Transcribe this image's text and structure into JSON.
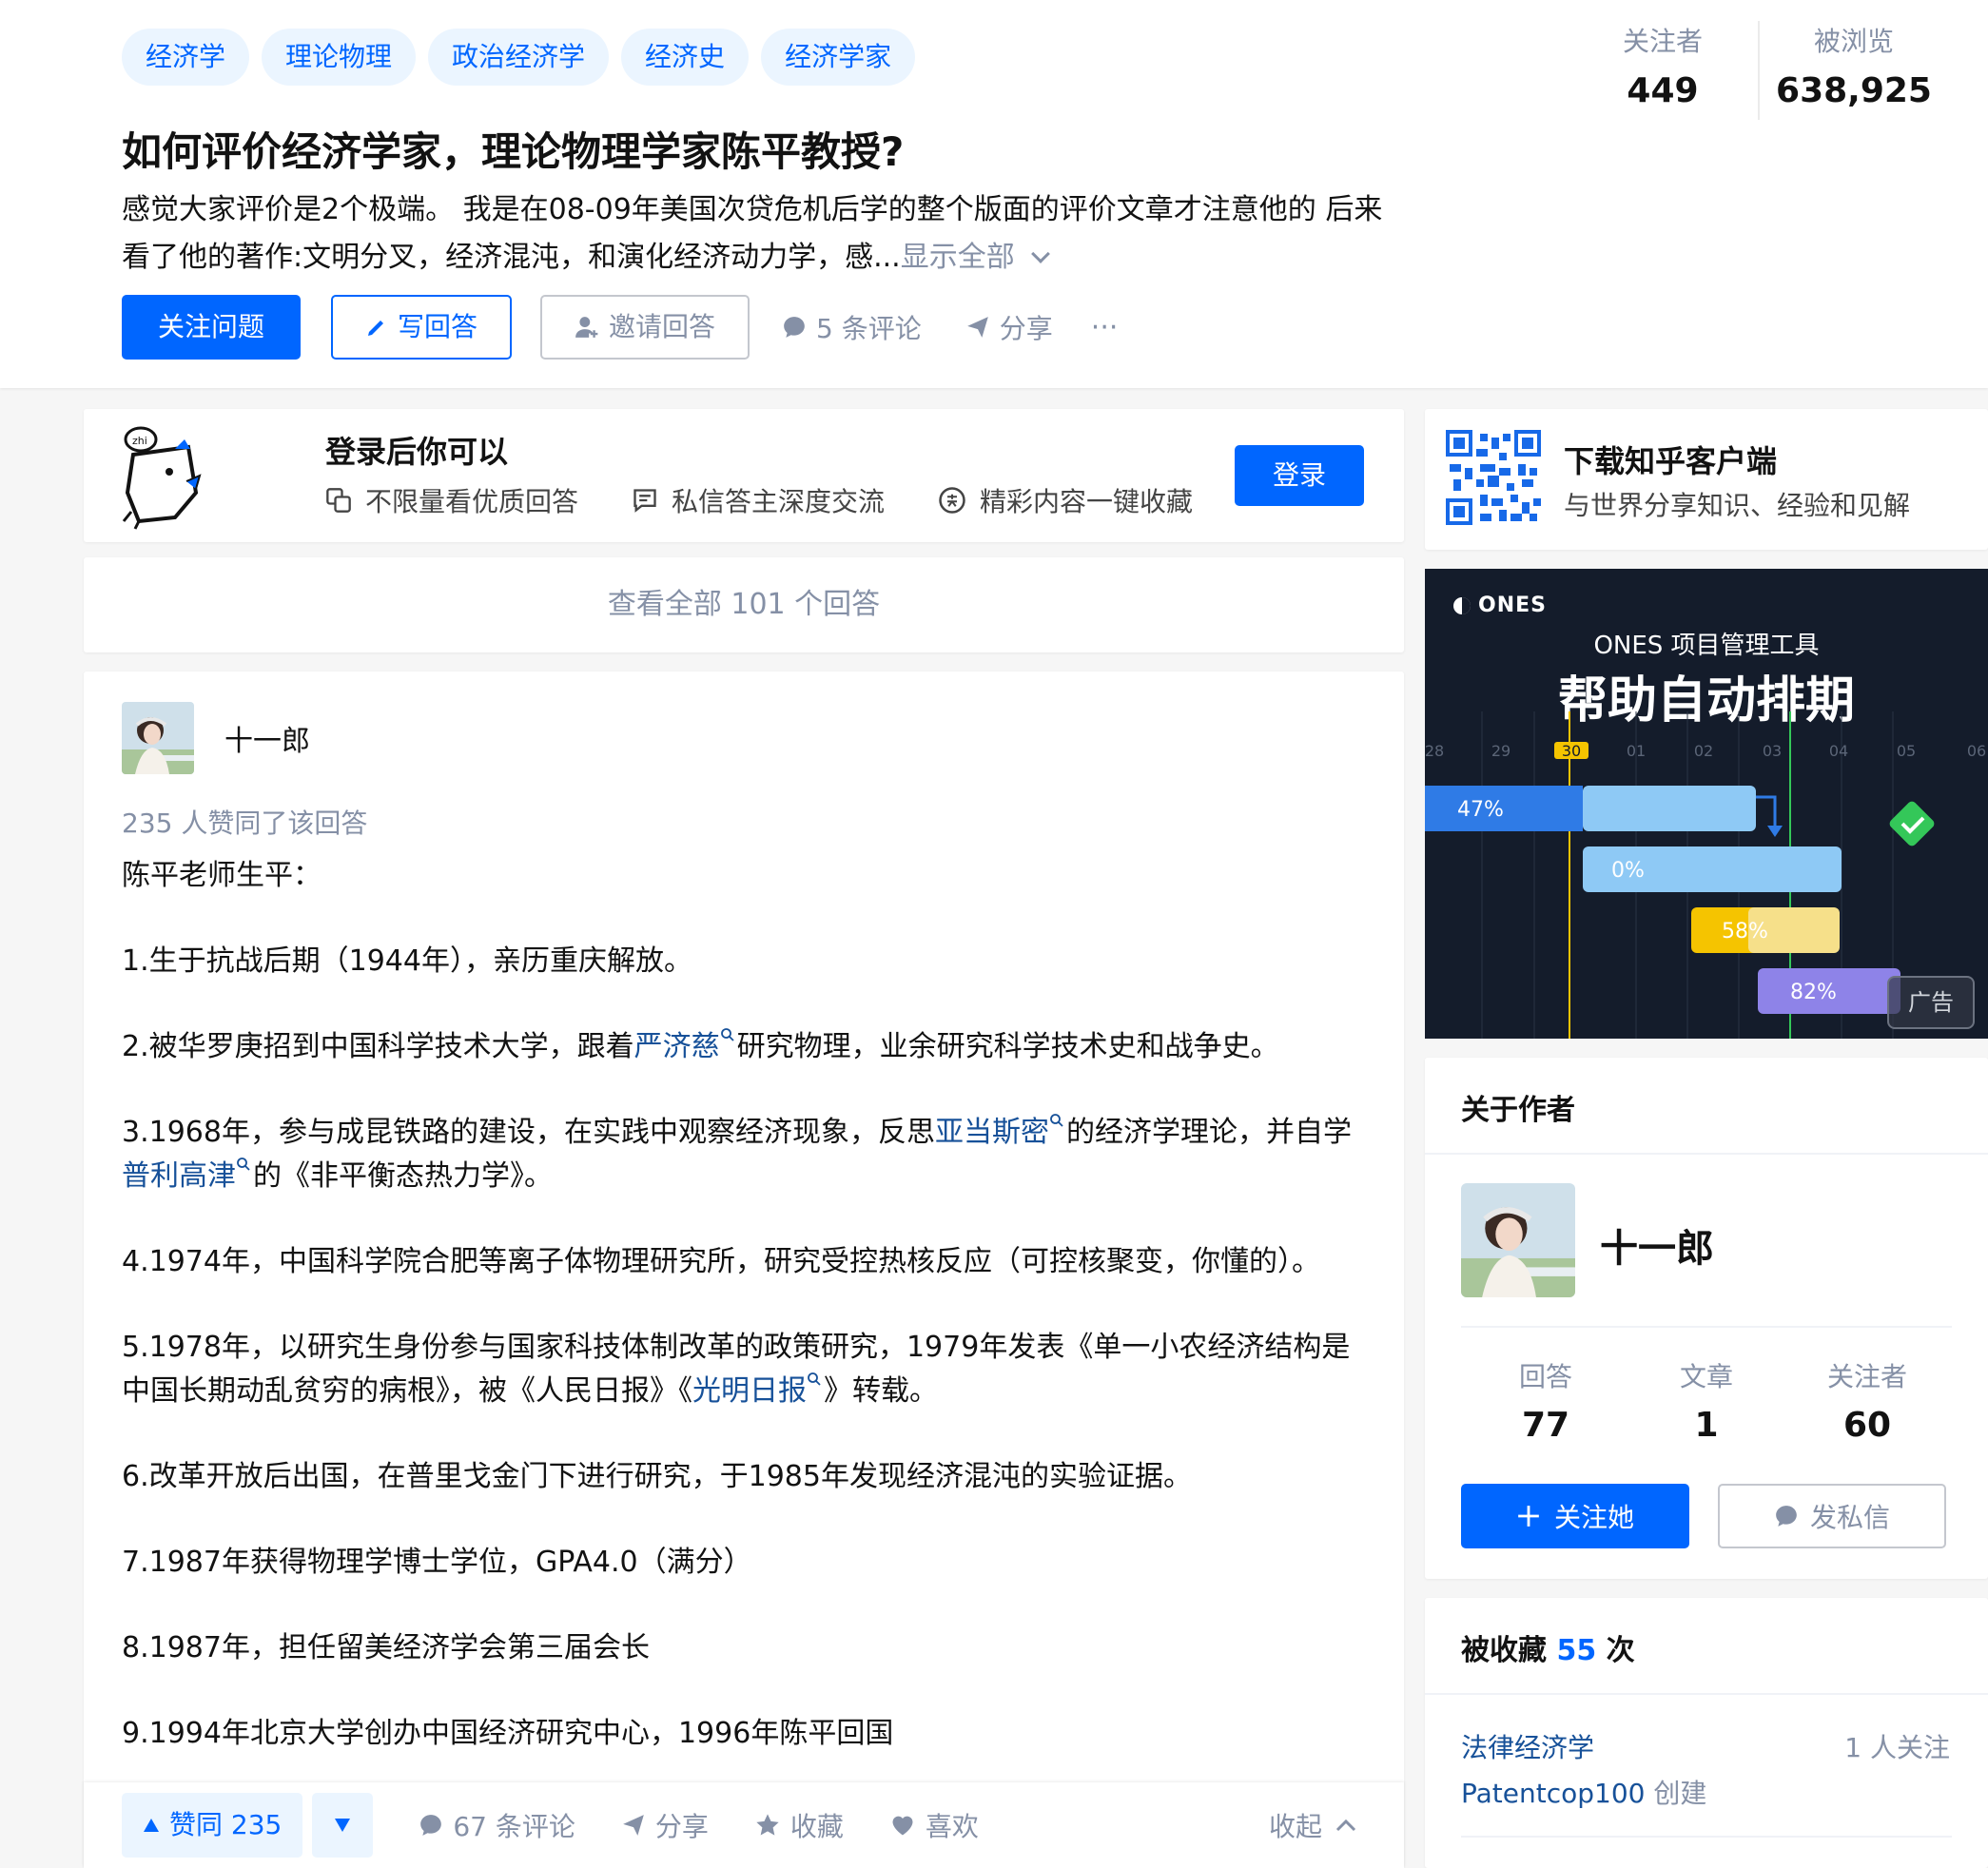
{
  "question": {
    "topics": [
      "经济学",
      "理论物理",
      "政治经济学",
      "经济史",
      "经济学家"
    ],
    "title": "如何评价经济学家，理论物理学家陈平教授?",
    "detail_line1": "感觉大家评价是2个极端。 我是在08-09年美国次贷危机后学的整个版面的评价文章才注意他的 后来",
    "detail_line2": "看了他的著作:文明分叉，经济混沌，和演化经济动力学，感...",
    "show_all": "显示全部",
    "actions": {
      "follow": "关注问题",
      "write": "写回答",
      "invite": "邀请回答",
      "comments": "5 条评论",
      "share": "分享",
      "more": "···"
    },
    "stats": {
      "followers_label": "关注者",
      "followers": "449",
      "views_label": "被浏览",
      "views": "638,925"
    }
  },
  "login_prompt": {
    "title": "登录后你可以",
    "features": [
      "不限量看优质回答",
      "私信答主深度交流",
      "精彩内容一键收藏"
    ],
    "login": "登录"
  },
  "all_answers": "查看全部 101 个回答",
  "answer": {
    "author": "十一郎",
    "votes_line": "235 人赞同了该回答",
    "intro": "陈平老师生平：",
    "items": {
      "i1": "1.生于抗战后期（1944年），亲历重庆解放。",
      "i2_a": "2.被华罗庚招到中国科学技术大学，跟着",
      "i2_link": "严济慈",
      "i2_b": "研究物理，业余研究科学技术史和战争史。",
      "i3_a": "3.1968年，参与成昆铁路的建设，在实践中观察经济现象，反思",
      "i3_link1": "亚当斯密",
      "i3_b": "的经济学理论，并自学",
      "i3_link2": "普利高津",
      "i3_c": "的《非平衡态热力学》。",
      "i4": "4.1974年，中国科学院合肥等离子体物理研究所，研究受控热核反应（可控核聚变，你懂的）。",
      "i5_a": "5.1978年，以研究生身份参与国家科技体制改革的政策研究，1979年发表《单一小农经济结构是",
      "i5_b": "中国长期动乱贫穷的病根》，被《人民日报》《",
      "i5_link": "光明日报",
      "i5_c": "》转载。",
      "i6": "6.改革开放后出国，在普里戈金门下进行研究，于1985年发现经济混沌的实验证据。",
      "i7": "7.1987年获得物理学博士学位，GPA4.0（满分）",
      "i8": "8.1987年，担任留美经济学会第三届会长",
      "i9": "9.1994年北京大学创办中国经济研究中心，1996年陈平回国"
    },
    "footer": {
      "upvote": "赞同 235",
      "comments": "67 条评论",
      "share": "分享",
      "collect": "收藏",
      "like": "喜欢",
      "collapse": "收起"
    }
  },
  "sidebar": {
    "download": {
      "title": "下载知乎客户端",
      "subtitle": "与世界分享知识、经验和见解"
    },
    "ad": {
      "brand": "ONES",
      "subtitle": "ONES 项目管理工具",
      "headline": "帮助自动排期",
      "dates": [
        "28",
        "29",
        "30",
        "01",
        "02",
        "03",
        "04",
        "05",
        "06"
      ],
      "bars": [
        "47%",
        "0%",
        "58%",
        "82%"
      ],
      "tag": "广告"
    },
    "about": {
      "title": "关于作者",
      "name": "十一郎",
      "answers_label": "回答",
      "answers": "77",
      "articles_label": "文章",
      "articles": "1",
      "followers_label": "关注者",
      "followers": "60",
      "follow": "关注她",
      "message": "发私信"
    },
    "collected": {
      "prefix": "被收藏",
      "count": "55",
      "suffix": "次",
      "item_name": "法律经济学",
      "item_followers": "1 人关注",
      "item_creator": "Patentcop100",
      "item_created": "创建"
    }
  },
  "colors": {
    "brand": "#0066ff",
    "link": "#175199",
    "muted": "#8590a6",
    "ad_bg": "#141c2b"
  }
}
